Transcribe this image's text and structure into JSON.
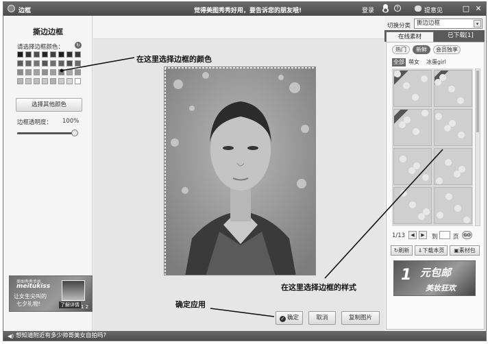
{
  "window": {
    "title": "边框",
    "slogan": "觉得美图秀秀好用，要告诉您的朋友哦!",
    "login": "登录",
    "help_glyph": "?",
    "feedback": "提意见",
    "minimize_glyph": "□",
    "close_glyph": "✕"
  },
  "left_panel": {
    "title": "撕边边框",
    "color_label": "请选择边框颜色：",
    "reset_glyph": "↻",
    "swatch_colors": [
      "#1a1a1a",
      "#333333",
      "#4d4d4d",
      "#262626",
      "#404040",
      "#1f1f1f",
      "#2e2e2e",
      "#3a3a3a",
      "#5a5a5a",
      "#666666",
      "#777777",
      "#555555",
      "#707070",
      "#606060",
      "#4f4f4f",
      "#6a6a6a",
      "#8a8a8a",
      "#999999",
      "#a3a3a3",
      "#8f8f8f",
      "#9e9e9e",
      "#858585",
      "#aaaaaa",
      "#959595",
      "#b5b5b5",
      "#c2c2c2",
      "#bdbdbd",
      "#c8c8c8",
      "#b0b0b0",
      "#cccccc",
      "#d6d6d6",
      "#ffffff"
    ],
    "more_colors": "选择其他颜色",
    "opacity_label": "边框透明度：",
    "opacity_value": "100%",
    "opacity_fraction": 1.0
  },
  "left_ad": {
    "line1": "美图秀秀手机",
    "line2": "meitukiss",
    "line3": "让女生尖叫的",
    "line4": "七夕礼物!",
    "button": "了解详情",
    "pages": "1 2"
  },
  "status": {
    "speaker_glyph": "◀)",
    "text": "想知道附近有多少帅哥美女自拍吗?"
  },
  "buttons": {
    "ok": "确定",
    "ok_glyph": "✓",
    "cancel": "取消",
    "copy": "复制图片"
  },
  "right_panel": {
    "category_label": "切换分类",
    "category_value": "撕边边框",
    "dropdown_glyph": "▾",
    "tabs": [
      "在线素材",
      "已下载[1]"
    ],
    "subtabs": [
      "热门",
      "新鲜",
      "会员独享"
    ],
    "filters": [
      "全部",
      "萌女",
      "冰蛋girl"
    ],
    "pager": {
      "text": "1/13",
      "prev_glyph": "◀",
      "next_glyph": "▶",
      "goto": "到",
      "unit": "页",
      "go": "GO"
    },
    "actions": [
      "刷新",
      "下载本页",
      "素材包"
    ],
    "action_glyphs": [
      "↻",
      "⇓",
      "▣"
    ],
    "ad": {
      "big": "1",
      "small": "元包邮",
      "sub": "美妆狂欢"
    }
  },
  "annotations": {
    "color": "在这里选择边框的颜色",
    "style": "在这里选择边框的样式",
    "apply": "确定应用"
  }
}
